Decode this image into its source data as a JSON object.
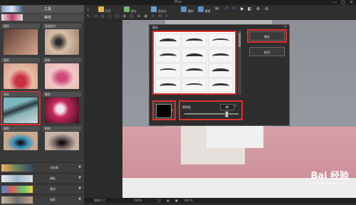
{
  "window": {
    "title": "Pics",
    "controls": [
      "—",
      "□",
      "✕"
    ]
  },
  "left_panel": {
    "banner_top_label": "工具",
    "banner_second_label": "美容",
    "cells": [
      {
        "label": "瘦脸",
        "color": "#c79a86"
      },
      {
        "label": "面部放大",
        "color": "#d2b7a0"
      },
      {
        "label": "唇彩",
        "color": "#c45a63"
      },
      {
        "label": "唇彩",
        "color": "#d8a0a3"
      },
      {
        "label": "眉毛",
        "color": "#7aa4aa",
        "selected": true
      },
      {
        "label": "睫毛",
        "color": "#b02a4a"
      },
      {
        "label": "眼影",
        "color": "#3d7fa6"
      },
      {
        "label": "眼线",
        "color": "#6b5a5a"
      }
    ],
    "categories": [
      {
        "label": "光效果",
        "arrow": "▼"
      },
      {
        "label": "模板",
        "arrow": "▼"
      },
      {
        "label": "素材",
        "arrow": "▼"
      },
      {
        "label": "相框",
        "arrow": "▼"
      }
    ]
  },
  "toolbar": {
    "items": [
      {
        "label": "打开",
        "icon": "open-folder-icon"
      },
      {
        "label": "保存",
        "icon": "save-icon"
      },
      {
        "label": "另存为",
        "icon": "save-as-icon"
      },
      {
        "label": "撤销",
        "icon": "undo-icon"
      },
      {
        "label": "重做",
        "icon": "redo-icon"
      }
    ],
    "tools_row": "↖ ▭ ○ ◌ ▢ ◑ ◫ ⊕ ▦ ✧ ⟲ ⌇"
  },
  "dialog": {
    "title": "眉毛",
    "close": "✕",
    "ok_label": "确定",
    "cancel_label": "取消",
    "opacity_label": "透明度",
    "opacity_value": "80",
    "opacity_fraction": 0.78,
    "color": "#000000",
    "brush_count": 12
  },
  "canvas": {
    "watermark_brand": "Bai 经验",
    "watermark_url": "jingyan.baidu.com"
  },
  "statusbar": {
    "items": [
      "图像尺寸",
      "100%",
      "◰",
      "▣",
      "■",
      "100 %"
    ]
  },
  "colors": {
    "accent_highlight": "#e03030",
    "panel_bg": "#3a3a3a"
  }
}
